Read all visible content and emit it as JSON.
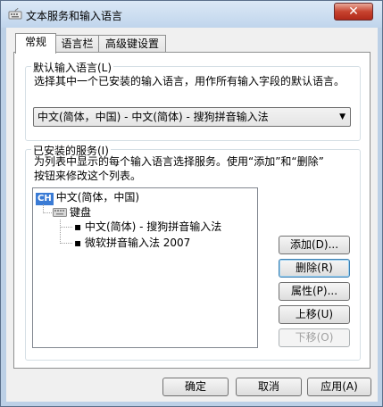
{
  "window": {
    "title": "文本服务和输入语言",
    "close_label": "✕"
  },
  "tabs": [
    {
      "label": "常规",
      "active": true
    },
    {
      "label": "语言栏",
      "active": false
    },
    {
      "label": "高级键设置",
      "active": false
    }
  ],
  "default_language": {
    "group_title": "默认输入语言(L)",
    "description": "选择其中一个已安装的输入语言，用作所有输入字段的默认语言。",
    "selected": "中文(简体，中国) - 中文(简体) - 搜狗拼音输入法"
  },
  "installed_services": {
    "group_title": "已安装的服务(I)",
    "description_line1": "为列表中显示的每个输入语言选择服务。使用“添加”和“删除”",
    "description_line2": "按钮来修改这个列表。",
    "tree": {
      "language_badge": "CH",
      "language": "中文(简体，中国)",
      "category": "键盘",
      "services": [
        "中文(简体) - 搜狗拼音输入法",
        "微软拼音输入法 2007"
      ]
    },
    "buttons": {
      "add": "添加(D)...",
      "remove": "删除(R)",
      "properties": "属性(P)...",
      "move_up": "上移(U)",
      "move_down": "下移(O)"
    }
  },
  "footer": {
    "ok": "确定",
    "cancel": "取消",
    "apply": "应用(A)"
  }
}
